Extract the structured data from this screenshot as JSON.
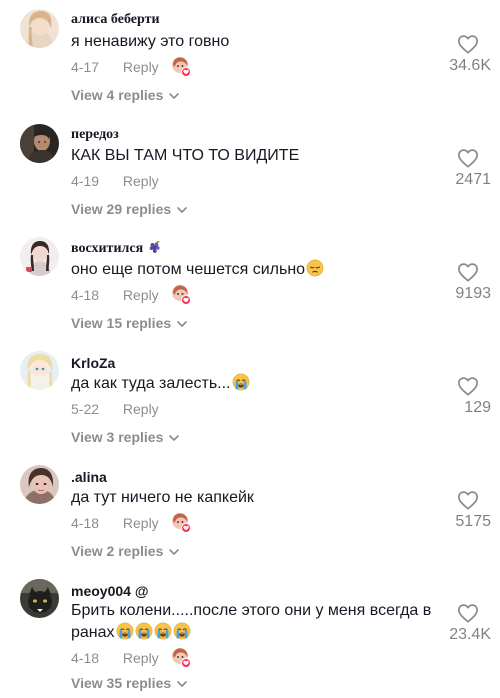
{
  "reply_label": "Reply",
  "comments": [
    {
      "username": "алиса беберти",
      "text": "я ненавижу это говно",
      "date": "4-17",
      "likes": "34.6K",
      "view_replies": "View 4 replies",
      "creator_liked": true
    },
    {
      "username": "передоз",
      "text": "КАК ВЫ ТАМ ЧТО ТО ВИДИТЕ",
      "date": "4-19",
      "likes": "2471",
      "view_replies": "View 29 replies",
      "creator_liked": false
    },
    {
      "username": "восхитился",
      "username_emoji": "grapes",
      "text": "оно еще потом чешется сильно",
      "text_emoji": "pensive-face",
      "date": "4-18",
      "likes": "9193",
      "view_replies": "View 15 replies",
      "creator_liked": true
    },
    {
      "username": "KrloZa",
      "text": "да как туда залесть...",
      "text_emoji": "crying-face",
      "date": "5-22",
      "likes": "129",
      "view_replies": "View 3 replies",
      "creator_liked": false
    },
    {
      "username": ".alina",
      "text": "да тут ничего не капкейк",
      "date": "4-18",
      "likes": "5175",
      "view_replies": "View 2 replies",
      "creator_liked": true
    },
    {
      "username": "meoy004 @",
      "text_line1": "Брить колени.....после этого они у меня всегда в",
      "text_line2": "ранах",
      "text_emojis": [
        "crying-face",
        "crying-face",
        "crying-face",
        "crying-face"
      ],
      "date": "4-18",
      "likes": "23.4K",
      "view_replies": "View 35 replies",
      "creator_liked": true
    }
  ]
}
